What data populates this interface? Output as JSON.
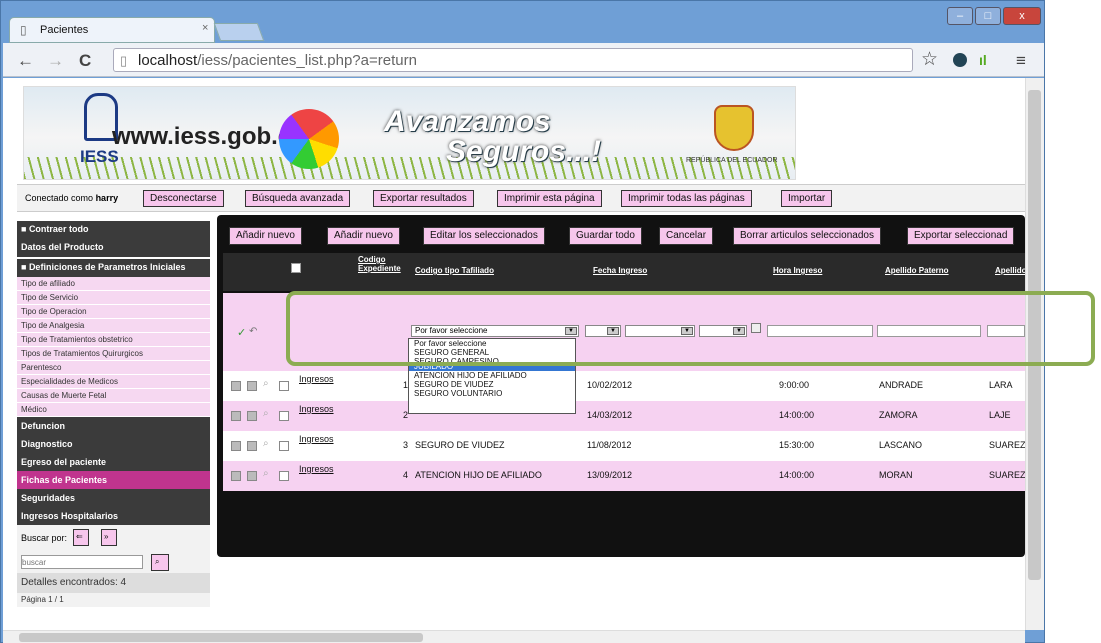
{
  "browser": {
    "tab_title": "Pacientes",
    "tab_close": "×",
    "url_host": "localhost",
    "url_path": "/iess/pacientes_list.php?a=return",
    "back": "←",
    "forward": "→",
    "reload": "C",
    "star": "☆",
    "menu": "≡",
    "win_min": "–",
    "win_max": "□",
    "win_close": "x"
  },
  "banner": {
    "site": "www.iess.gob.ec",
    "iess": "IESS",
    "slogan1": "Avanzamos",
    "slogan2": "Seguros...!",
    "republic": "REPÚBLICA DEL ECUADOR"
  },
  "userbar": {
    "connected_label": "Conectado como",
    "username": "harry",
    "buttons": [
      "Desconectarse",
      "Búsqueda avanzada",
      "Exportar resultados",
      "Imprimir esta página",
      "Imprimir todas las páginas",
      "Importar"
    ]
  },
  "sidebar": {
    "collapse": "Contraer todo",
    "producto": "Datos del Producto",
    "definiciones": "Definiciones de Parametros Iniciales",
    "items": [
      "Tipo de afiliado",
      "Tipo de Servicio",
      "Tipo de Operacion",
      "Tipo de Analgesia",
      "Tipo de Tratamientos obstetrico",
      "Tipos de Tratamientos Quirurgicos",
      "Parentesco",
      "Especialidades de Medicos",
      "Causas de Muerte Fetal",
      "Médico"
    ],
    "sections": [
      "Defuncion",
      "Diagnostico",
      "Egreso del paciente",
      "Fichas de Pacientes",
      "Seguridades",
      "Ingresos Hospitalarios"
    ],
    "search_by": "Buscar por:",
    "search_placeholder": "buscar",
    "found": "Detalles encontrados: 4",
    "page": "Página 1 / 1"
  },
  "grid": {
    "actions": [
      "Añadir nuevo",
      "Añadir nuevo",
      "Editar los seleccionados",
      "Guardar todo",
      "Cancelar",
      "Borrar articulos seleccionados",
      "Exportar seleccionad"
    ],
    "headers": {
      "codigo1": "Codigo",
      "codigo2": "Expediente",
      "tipo": "Codigo tipo Tafiliado",
      "fecha": "Fecha Ingreso",
      "hora": "Hora Ingreso",
      "paterno": "Apellido Paterno",
      "materno": "Apellido"
    },
    "select_value": "Por favor seleccione",
    "dropdown_options": [
      "Por favor seleccione",
      "SEGURO GENERAL",
      "SEGURO CAMPESINO",
      "JUBILADO",
      "ATENCION HIJO DE AFILIADO",
      "SEGURO DE VIUDEZ",
      "SEGURO VOLUNTARIO"
    ],
    "rows": [
      {
        "link": "Ingresos",
        "num": "1",
        "tipo": "",
        "fecha": "10/02/2012",
        "hora": "9:00:00",
        "paterno": "ANDRADE",
        "materno": "LARA"
      },
      {
        "link": "Ingresos",
        "num": "2",
        "tipo": "",
        "fecha": "14/03/2012",
        "hora": "14:00:00",
        "paterno": "ZAMORA",
        "materno": "LAJE"
      },
      {
        "link": "Ingresos",
        "num": "3",
        "tipo": "SEGURO DE VIUDEZ",
        "fecha": "11/08/2012",
        "hora": "15:30:00",
        "paterno": "LASCANO",
        "materno": "SUAREZ"
      },
      {
        "link": "Ingresos",
        "num": "4",
        "tipo": "ATENCION HIJO DE AFILIADO",
        "fecha": "13/09/2012",
        "hora": "14:00:00",
        "paterno": "MORAN",
        "materno": "SUAREZ"
      }
    ]
  },
  "colors": {
    "accent_pink": "#f7c6ec",
    "highlight_green": "#8cac52",
    "dark": "#111111"
  }
}
